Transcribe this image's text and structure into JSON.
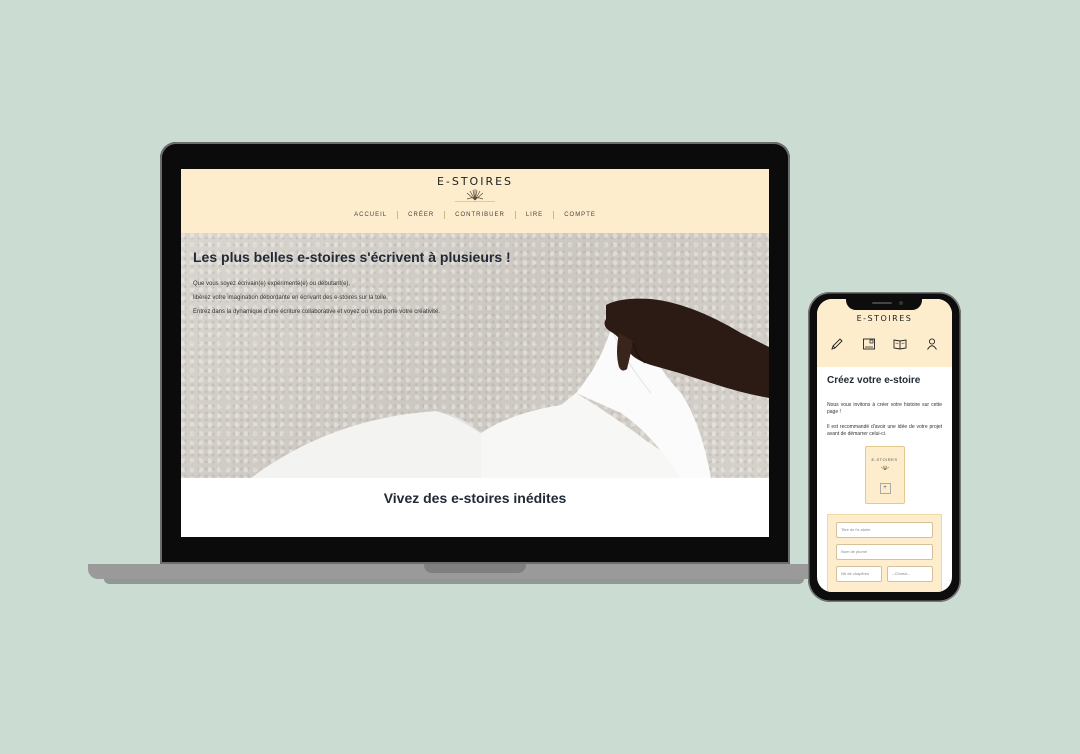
{
  "desktop": {
    "brand": "E-STOIRES",
    "nav": [
      "ACCUEIL",
      "CRÉER",
      "CONTRIBUER",
      "LIRE",
      "COMPTE"
    ],
    "hero": {
      "title": "Les plus belles e-stoires s'écrivent à plusieurs !",
      "lines": [
        "Que vous soyez écrivain(e) expérimenté(e) ou débutant(e),",
        "libérez votre imagination débordante en écrivant des e-stoires sur la toile.",
        "Entrez dans la dynamique d'une écriture collaborative et voyez où vous porte votre créativité."
      ]
    },
    "section_title": "Vivez des e-stoires inédites"
  },
  "mobile": {
    "brand": "E-STOIRES",
    "icons": [
      "pencil-icon",
      "tablet-icon",
      "open-book-icon",
      "user-icon"
    ],
    "title": "Créez votre e-stoire",
    "paragraphs": [
      "Nous vous invitons à créer votre histoire sur cette page !",
      "Il est recommandé d'avoir une idée de votre projet avant de démarrer celui-ci."
    ],
    "book_cover_label": "E-STOIRES",
    "book_cover_action": "+",
    "form": {
      "title_placeholder": "Titre de l'e-stoire",
      "pen_name_placeholder": "Nom de plume",
      "third_placeholder": "Nb de chapitres",
      "select_label": "--Choisir--"
    }
  },
  "colors": {
    "background": "#cbddd3",
    "header_cream": "#fdedcd",
    "text_dark": "#222a35"
  }
}
